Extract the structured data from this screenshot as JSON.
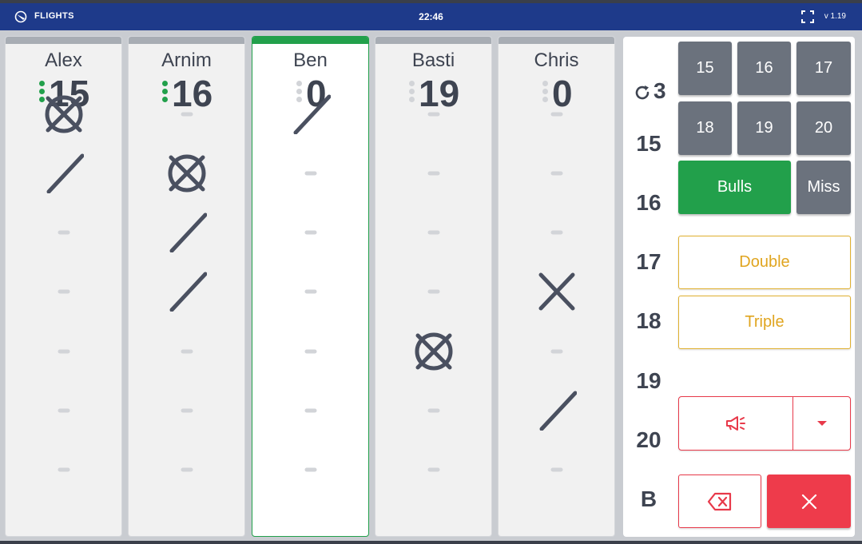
{
  "header": {
    "app_title": "FLIGHTS",
    "clock": "22:46",
    "version": "v 1.19",
    "brand_color": "#1e3a8a"
  },
  "players": [
    {
      "name": "Alex",
      "score": "15",
      "active": false,
      "indicator": "green",
      "marks": {
        "15": "closed",
        "16": "single",
        "17": "none",
        "18": "none",
        "19": "none",
        "20": "none",
        "B": "none"
      }
    },
    {
      "name": "Arnim",
      "score": "16",
      "active": false,
      "indicator": "green",
      "marks": {
        "15": "none",
        "16": "closed",
        "17": "single",
        "18": "single",
        "19": "none",
        "20": "none",
        "B": "none"
      }
    },
    {
      "name": "Ben",
      "score": "0",
      "active": true,
      "indicator": "gray",
      "marks": {
        "15": "single",
        "16": "none",
        "17": "none",
        "18": "none",
        "19": "none",
        "20": "none",
        "B": "none"
      }
    },
    {
      "name": "Basti",
      "score": "19",
      "active": false,
      "indicator": "gray",
      "marks": {
        "15": "none",
        "16": "none",
        "17": "none",
        "18": "none",
        "19": "closed",
        "20": "none",
        "B": "none"
      }
    },
    {
      "name": "Chris",
      "score": "0",
      "active": false,
      "indicator": "gray",
      "marks": {
        "15": "none",
        "16": "none",
        "17": "none",
        "18": "double",
        "19": "none",
        "20": "single",
        "B": "none"
      }
    }
  ],
  "board": {
    "round_icon": "refresh-icon",
    "round": "3",
    "targets": [
      "15",
      "16",
      "17",
      "18",
      "19",
      "20",
      "B"
    ]
  },
  "keypad": {
    "numbers": [
      "15",
      "16",
      "17",
      "18",
      "19",
      "20"
    ],
    "bulls": "Bulls",
    "miss": "Miss",
    "double": "Double",
    "triple": "Triple",
    "announce_icon": "megaphone-icon",
    "dropdown_icon": "caret-down-icon",
    "backspace_icon": "backspace-icon",
    "close_icon": "close-icon"
  },
  "colors": {
    "active": "#22a04b",
    "accent_yellow": "#e0a520",
    "accent_red": "#e8394a",
    "mark": "#4a5060"
  }
}
